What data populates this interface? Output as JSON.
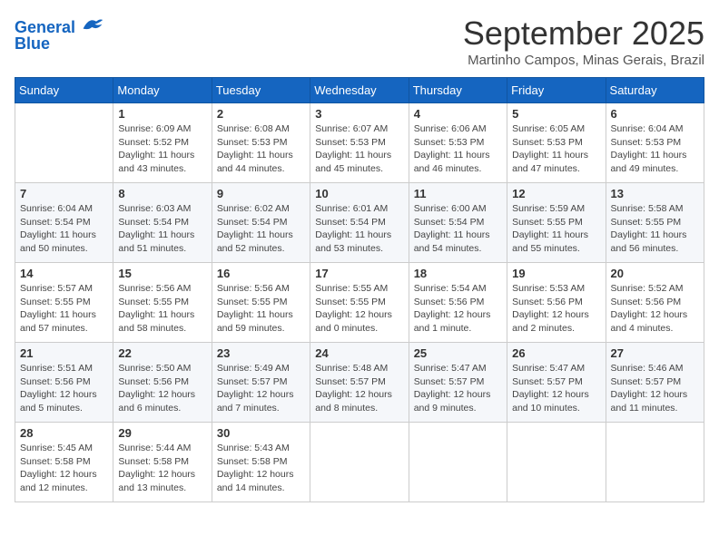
{
  "header": {
    "logo_line1": "General",
    "logo_line2": "Blue",
    "month": "September 2025",
    "location": "Martinho Campos, Minas Gerais, Brazil"
  },
  "days_of_week": [
    "Sunday",
    "Monday",
    "Tuesday",
    "Wednesday",
    "Thursday",
    "Friday",
    "Saturday"
  ],
  "weeks": [
    [
      {
        "day": "",
        "info": ""
      },
      {
        "day": "1",
        "info": "Sunrise: 6:09 AM\nSunset: 5:52 PM\nDaylight: 11 hours\nand 43 minutes."
      },
      {
        "day": "2",
        "info": "Sunrise: 6:08 AM\nSunset: 5:53 PM\nDaylight: 11 hours\nand 44 minutes."
      },
      {
        "day": "3",
        "info": "Sunrise: 6:07 AM\nSunset: 5:53 PM\nDaylight: 11 hours\nand 45 minutes."
      },
      {
        "day": "4",
        "info": "Sunrise: 6:06 AM\nSunset: 5:53 PM\nDaylight: 11 hours\nand 46 minutes."
      },
      {
        "day": "5",
        "info": "Sunrise: 6:05 AM\nSunset: 5:53 PM\nDaylight: 11 hours\nand 47 minutes."
      },
      {
        "day": "6",
        "info": "Sunrise: 6:04 AM\nSunset: 5:53 PM\nDaylight: 11 hours\nand 49 minutes."
      }
    ],
    [
      {
        "day": "7",
        "info": "Sunrise: 6:04 AM\nSunset: 5:54 PM\nDaylight: 11 hours\nand 50 minutes."
      },
      {
        "day": "8",
        "info": "Sunrise: 6:03 AM\nSunset: 5:54 PM\nDaylight: 11 hours\nand 51 minutes."
      },
      {
        "day": "9",
        "info": "Sunrise: 6:02 AM\nSunset: 5:54 PM\nDaylight: 11 hours\nand 52 minutes."
      },
      {
        "day": "10",
        "info": "Sunrise: 6:01 AM\nSunset: 5:54 PM\nDaylight: 11 hours\nand 53 minutes."
      },
      {
        "day": "11",
        "info": "Sunrise: 6:00 AM\nSunset: 5:54 PM\nDaylight: 11 hours\nand 54 minutes."
      },
      {
        "day": "12",
        "info": "Sunrise: 5:59 AM\nSunset: 5:55 PM\nDaylight: 11 hours\nand 55 minutes."
      },
      {
        "day": "13",
        "info": "Sunrise: 5:58 AM\nSunset: 5:55 PM\nDaylight: 11 hours\nand 56 minutes."
      }
    ],
    [
      {
        "day": "14",
        "info": "Sunrise: 5:57 AM\nSunset: 5:55 PM\nDaylight: 11 hours\nand 57 minutes."
      },
      {
        "day": "15",
        "info": "Sunrise: 5:56 AM\nSunset: 5:55 PM\nDaylight: 11 hours\nand 58 minutes."
      },
      {
        "day": "16",
        "info": "Sunrise: 5:56 AM\nSunset: 5:55 PM\nDaylight: 11 hours\nand 59 minutes."
      },
      {
        "day": "17",
        "info": "Sunrise: 5:55 AM\nSunset: 5:55 PM\nDaylight: 12 hours\nand 0 minutes."
      },
      {
        "day": "18",
        "info": "Sunrise: 5:54 AM\nSunset: 5:56 PM\nDaylight: 12 hours\nand 1 minute."
      },
      {
        "day": "19",
        "info": "Sunrise: 5:53 AM\nSunset: 5:56 PM\nDaylight: 12 hours\nand 2 minutes."
      },
      {
        "day": "20",
        "info": "Sunrise: 5:52 AM\nSunset: 5:56 PM\nDaylight: 12 hours\nand 4 minutes."
      }
    ],
    [
      {
        "day": "21",
        "info": "Sunrise: 5:51 AM\nSunset: 5:56 PM\nDaylight: 12 hours\nand 5 minutes."
      },
      {
        "day": "22",
        "info": "Sunrise: 5:50 AM\nSunset: 5:56 PM\nDaylight: 12 hours\nand 6 minutes."
      },
      {
        "day": "23",
        "info": "Sunrise: 5:49 AM\nSunset: 5:57 PM\nDaylight: 12 hours\nand 7 minutes."
      },
      {
        "day": "24",
        "info": "Sunrise: 5:48 AM\nSunset: 5:57 PM\nDaylight: 12 hours\nand 8 minutes."
      },
      {
        "day": "25",
        "info": "Sunrise: 5:47 AM\nSunset: 5:57 PM\nDaylight: 12 hours\nand 9 minutes."
      },
      {
        "day": "26",
        "info": "Sunrise: 5:47 AM\nSunset: 5:57 PM\nDaylight: 12 hours\nand 10 minutes."
      },
      {
        "day": "27",
        "info": "Sunrise: 5:46 AM\nSunset: 5:57 PM\nDaylight: 12 hours\nand 11 minutes."
      }
    ],
    [
      {
        "day": "28",
        "info": "Sunrise: 5:45 AM\nSunset: 5:58 PM\nDaylight: 12 hours\nand 12 minutes."
      },
      {
        "day": "29",
        "info": "Sunrise: 5:44 AM\nSunset: 5:58 PM\nDaylight: 12 hours\nand 13 minutes."
      },
      {
        "day": "30",
        "info": "Sunrise: 5:43 AM\nSunset: 5:58 PM\nDaylight: 12 hours\nand 14 minutes."
      },
      {
        "day": "",
        "info": ""
      },
      {
        "day": "",
        "info": ""
      },
      {
        "day": "",
        "info": ""
      },
      {
        "day": "",
        "info": ""
      }
    ]
  ]
}
